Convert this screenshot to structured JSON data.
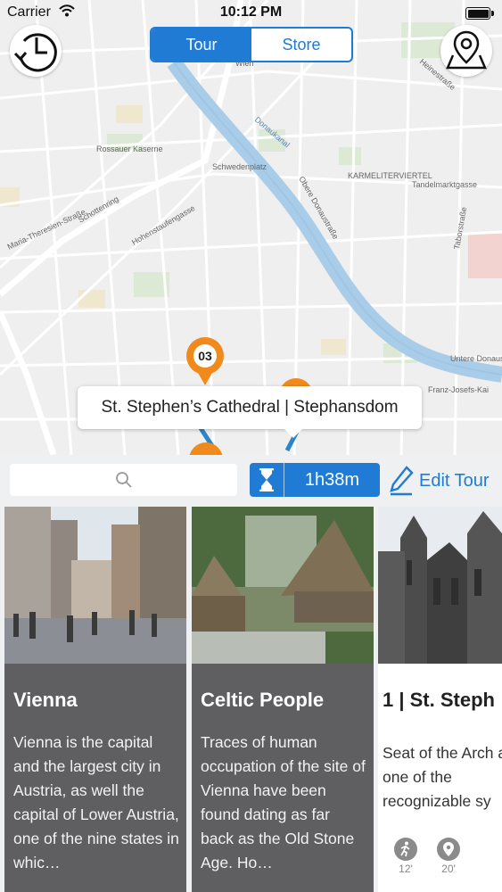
{
  "status_bar": {
    "carrier": "Carrier",
    "time": "10:12 PM"
  },
  "header": {
    "tabs": [
      {
        "label": "Tour",
        "active": true
      },
      {
        "label": "Store",
        "active": false
      }
    ],
    "left_button_icon": "history-clock-icon",
    "right_button_icon": "map-pins-icon"
  },
  "map": {
    "labels": {
      "wien": "Wien",
      "donaukanal": "Donaukanal",
      "rossauer_kaserne": "Rossauer Kaserne",
      "schwedenplatz": "Schwedenplatz",
      "obere_donaustrasse": "Obere Donaustraße",
      "untere_donaustrasse": "Untere Donaustraße",
      "franz_josefs_kai": "Franz-Josefs-Kai",
      "maria_theresien": "Maria-Theresien-Straße",
      "schottenring": "Schottenring",
      "hohenstaufengasse": "Hohenstaufengasse",
      "taborstrasse": "Taborstraße",
      "karmelitermarkt": "KARMELITERVIERTEL",
      "tandelmarktgasse": "Tandelmarktgasse",
      "heinestrasse": "Heinestraße"
    },
    "pin_number": "03",
    "callout_text": "St. Stephen’s Cathedral | Stephansdom"
  },
  "toolbar": {
    "search_icon": "search-icon",
    "duration": "1h38m",
    "edit_label": "Edit Tour"
  },
  "cards": [
    {
      "title": "Vienna",
      "text": "Vienna is the capital and the largest city in Austria, as well the capital of Lower Austria, one of the nine states in whic…"
    },
    {
      "title": "Celtic People",
      "text": "Traces of human occupation of the site of Vienna have been found dating as far back as the Old Stone Age. Ho…"
    },
    {
      "title": "1 | St. Steph",
      "text": "Seat of the Arch and one of the recognizable sy",
      "stats": [
        {
          "icon": "walk-icon",
          "value": "12'"
        },
        {
          "icon": "location-pin-icon",
          "value": "20'"
        }
      ]
    }
  ],
  "colors": {
    "accent": "#1f7bd4",
    "pin": "#f08a1c",
    "card_bg": "#5f5f61",
    "river": "#a9cde9"
  }
}
